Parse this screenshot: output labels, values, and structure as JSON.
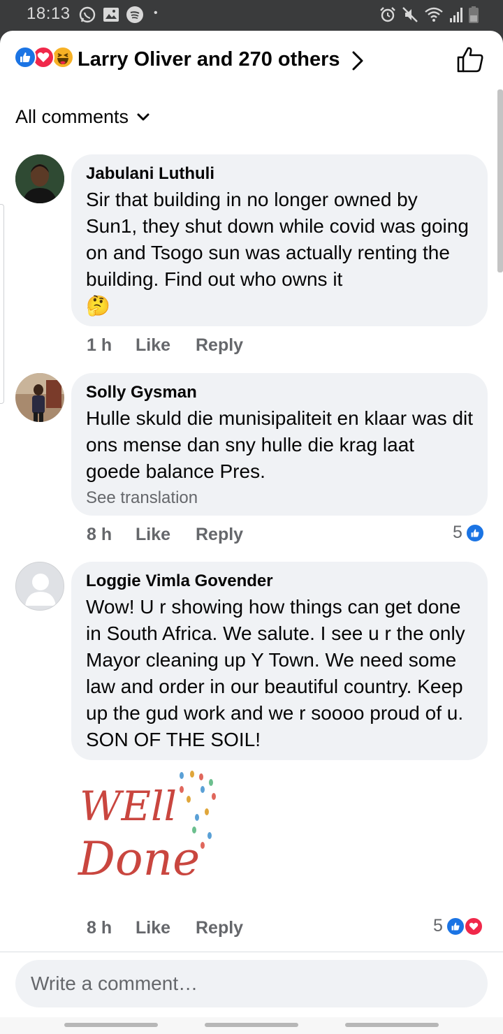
{
  "status_bar": {
    "time": "18:13",
    "dot": "•",
    "left_icons": [
      "whatsapp-icon",
      "gallery-icon",
      "spotify-icon"
    ],
    "right_icons": [
      "alarm-icon",
      "mute-icon",
      "wifi-icon",
      "signal-icon",
      "battery-icon"
    ]
  },
  "header": {
    "reaction_icons": [
      "like",
      "love",
      "haha"
    ],
    "reactors_text": "Larry Oliver and 270 others"
  },
  "filter": {
    "label": "All comments"
  },
  "comments": [
    {
      "author": "Jabulani Luthuli",
      "text": "Sir that building in no longer owned by Sun1, they shut down while covid was going on and Tsogo sun was actually renting the building. Find out who owns it",
      "emoji": "🤔",
      "time": "1 h",
      "like_label": "Like",
      "reply_label": "Reply"
    },
    {
      "author": "Solly Gysman",
      "text": "Hulle skuld die munisipaliteit en klaar was dit ons mense dan sny hulle die krag laat goede balance Pres.",
      "see_translation": "See translation",
      "time": "8 h",
      "like_label": "Like",
      "reply_label": "Reply",
      "reaction_count": "5"
    },
    {
      "author": "Loggie Vimla Govender",
      "text": "Wow! U r showing how things can get done in South Africa. We salute. I see u r the only Mayor cleaning up Y Town. We need some law and order in our beautiful country. Keep up the gud work and we r soooo proud of u. SON OF THE SOIL!",
      "sticker_text": "WELL Done",
      "time": "8 h",
      "like_label": "Like",
      "reply_label": "Reply",
      "reaction_count": "5"
    }
  ],
  "composer": {
    "placeholder": "Write a comment…"
  },
  "colors": {
    "like_blue": "#1b74e4",
    "love_red": "#f0284a",
    "haha_yellow": "#f7b125",
    "bubble_bg": "#f0f2f5",
    "secondary_text": "#65676b"
  }
}
